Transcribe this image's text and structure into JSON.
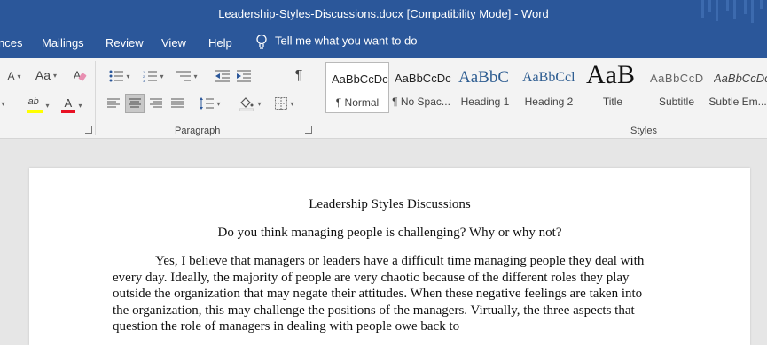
{
  "window": {
    "title": "Leadership-Styles-Discussions.docx [Compatibility Mode]  -  Word"
  },
  "menu": {
    "tabs": [
      "nces",
      "Mailings",
      "Review",
      "View",
      "Help"
    ],
    "tell_me": "Tell me what you want to do"
  },
  "ribbon": {
    "font_size_letter": "A",
    "change_case": "Aa",
    "highlight_letter": "ab",
    "font_color_letter": "A",
    "show_marks": "¶",
    "paragraph_group": "Paragraph",
    "styles_group": "Styles",
    "colors": {
      "highlight": "#ffff00",
      "font_color": "#e81123"
    },
    "styles": [
      {
        "sample": "AaBbCcDc",
        "label": "¶ Normal"
      },
      {
        "sample": "AaBbCcDc",
        "label": "¶ No Spac..."
      },
      {
        "sample": "AaBbC",
        "label": "Heading 1"
      },
      {
        "sample": "AaBbCcl",
        "label": "Heading 2"
      },
      {
        "sample": "AaB",
        "label": "Title"
      },
      {
        "sample": "AaBbCcD",
        "label": "Subtitle"
      },
      {
        "sample": "AaBbCcDc",
        "label": "Subtle Em..."
      }
    ]
  },
  "document": {
    "title": "Leadership Styles Discussions",
    "question": "Do you think managing people is challenging? Why or why not?",
    "paragraph": "Yes, I believe that managers or leaders have a difficult time managing people they deal with every day. Ideally, the majority of people are very chaotic because of the different roles they play outside the organization that may negate their attitudes. When these negative feelings are taken into the organization, this may challenge the positions of the managers. Virtually, the three aspects that question the role of managers in dealing with people owe back to"
  },
  "theme": {
    "titlebar": "#2b579a",
    "ribbon_bg": "#f3f3f3",
    "page_bg": "#e6e6e6"
  }
}
